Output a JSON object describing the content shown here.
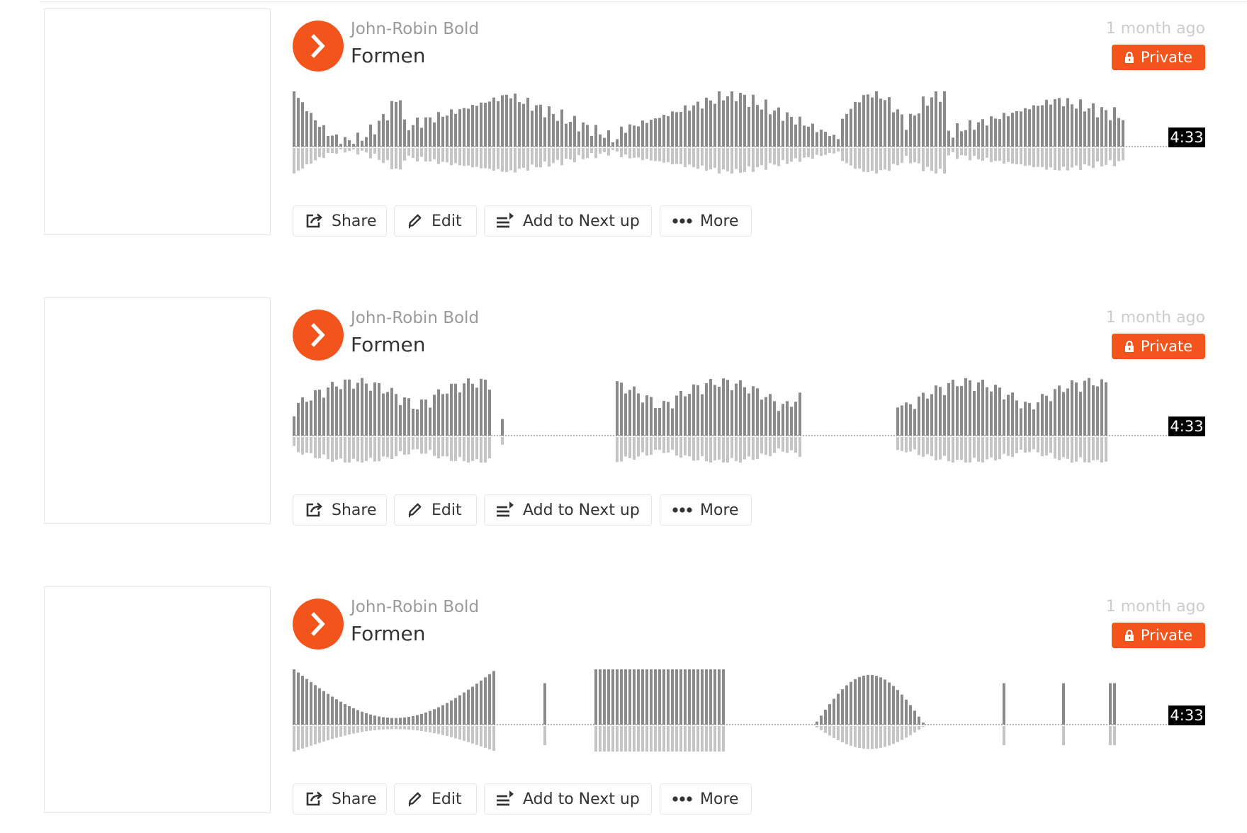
{
  "tracks": [
    {
      "artist": "John-Robin Bold",
      "title": "Formen",
      "posted": "1 month ago",
      "privacy_label": "Private",
      "duration": "4:33",
      "actions": {
        "share": "Share",
        "edit": "Edit",
        "next_up": "Add to Next up",
        "more": "More"
      },
      "waveform_pattern": "mixed"
    },
    {
      "artist": "John-Robin Bold",
      "title": "Formen",
      "posted": "1 month ago",
      "privacy_label": "Private",
      "duration": "4:33",
      "actions": {
        "share": "Share",
        "edit": "Edit",
        "next_up": "Add to Next up",
        "more": "More"
      },
      "waveform_pattern": "sparse-segments"
    },
    {
      "artist": "John-Robin Bold",
      "title": "Formen",
      "posted": "1 month ago",
      "privacy_label": "Private",
      "duration": "4:33",
      "actions": {
        "share": "Share",
        "edit": "Edit",
        "next_up": "Add to Next up",
        "more": "More"
      },
      "waveform_pattern": "shapes"
    }
  ],
  "colors": {
    "accent": "#f2541b",
    "waveform_bar": "#8a8a8a",
    "waveform_reflection": "#c4c4c4",
    "border": "#e5e5e5",
    "artist_text": "#999999",
    "title_text": "#333333",
    "timestamp_text": "#cccccc"
  },
  "icons": {
    "play": "play-icon",
    "lock": "lock-icon",
    "share": "share-icon",
    "edit": "pencil-icon",
    "next_up": "next-up-icon",
    "more": "more-dots-icon"
  }
}
